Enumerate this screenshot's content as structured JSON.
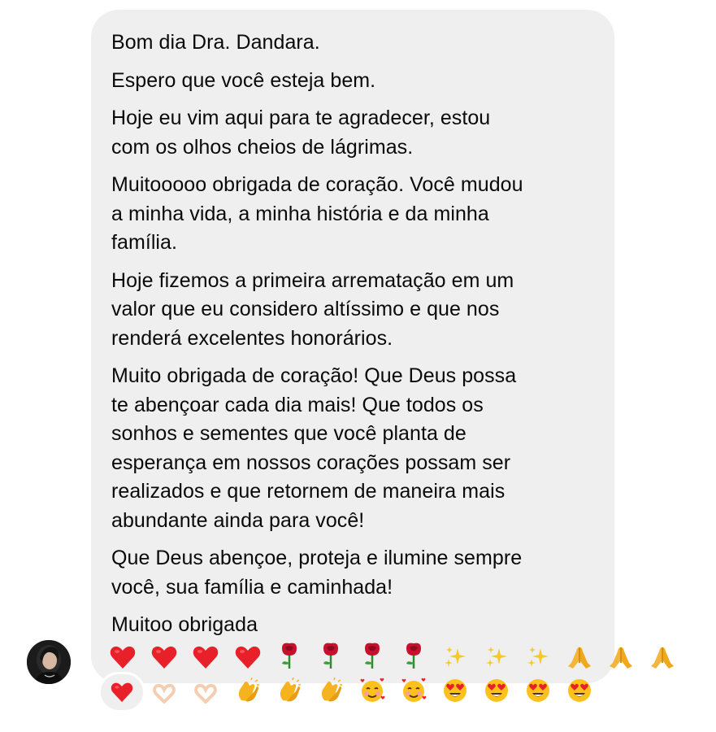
{
  "message": {
    "paragraphs": [
      "Bom dia Dra. Dandara.",
      "Espero que você esteja bem.",
      "Hoje eu vim aqui para te agradecer, estou\ncom os olhos cheios de lágrimas.",
      "Muitooooo obrigada de coração. Você mudou\na minha vida, a minha história e da minha\nfamília.",
      "Hoje fizemos a primeira arrematação em um\nvalor que eu considero altíssimo e que nos\nrenderá excelentes honorários.",
      "Muito obrigada de coração! Que Deus possa\nte abençoar cada dia mais! Que todos os\nsonhos e sementes que você planta de\nesperança em nossos corações possam ser\nrealizados e que retornem de maneira mais\nabundante ainda para você!",
      "Que Deus abençoe, proteja e ilumine sempre\nvocê, sua família e caminhada!",
      "Muitoo obrigada"
    ],
    "emoji_rows": [
      [
        "heart-icon",
        "heart-icon",
        "heart-icon",
        "heart-icon",
        "rose-icon",
        "rose-icon",
        "rose-icon",
        "rose-icon",
        "sparkles-icon",
        "sparkles-icon",
        "sparkles-icon",
        "praying-hands-icon",
        "praying-hands-icon",
        "praying-hands-icon"
      ],
      [
        "heart-hands-icon",
        "heart-hands-icon",
        "heart-hands-icon",
        "clapping-hands-icon",
        "clapping-hands-icon",
        "clapping-hands-icon",
        "smiling-face-with-hearts-icon",
        "smiling-face-with-hearts-icon",
        "heart-eyes-icon",
        "heart-eyes-icon",
        "heart-eyes-icon",
        "heart-eyes-icon"
      ]
    ]
  },
  "reaction": {
    "icon": "heart-icon"
  },
  "colors": {
    "bubble": "#efefef",
    "text": "#0a0a0a",
    "heart": "#e8202a"
  }
}
